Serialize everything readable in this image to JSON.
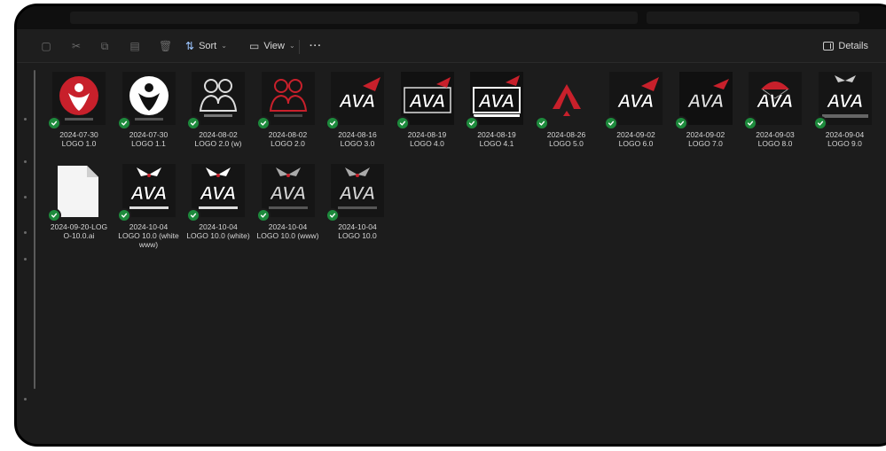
{
  "toolbar": {
    "sort_label": "Sort",
    "view_label": "View",
    "more_label": "···",
    "details_label": "Details"
  },
  "files": [
    {
      "date": "2024-07-30",
      "name": "LOGO 1.0",
      "thumb": "red-circle-figure"
    },
    {
      "date": "2024-07-30",
      "name": "LOGO 1.1",
      "thumb": "white-circle-figure"
    },
    {
      "date": "2024-08-02",
      "name": "LOGO 2.0 (w)",
      "thumb": "outline-people"
    },
    {
      "date": "2024-08-02",
      "name": "LOGO 2.0",
      "thumb": "red-people"
    },
    {
      "date": "2024-08-16",
      "name": "LOGO 3.0",
      "thumb": "ava-arrow"
    },
    {
      "date": "2024-08-19",
      "name": "LOGO 4.0",
      "thumb": "ava-box"
    },
    {
      "date": "2024-08-19",
      "name": "LOGO 4.1",
      "thumb": "ava-box-white"
    },
    {
      "date": "2024-08-26",
      "name": "LOGO 5.0",
      "thumb": "red-triangle"
    },
    {
      "date": "2024-09-02",
      "name": "LOGO 6.0",
      "thumb": "ava-arrow"
    },
    {
      "date": "2024-09-02",
      "name": "LOGO 7.0",
      "thumb": "ava-arrow-dark"
    },
    {
      "date": "2024-09-03",
      "name": "LOGO 8.0",
      "thumb": "ava-parachute"
    },
    {
      "date": "2024-09-04",
      "name": "LOGO 9.0",
      "thumb": "ava-wings"
    },
    {
      "date": "2024-09-20-LOG",
      "name": "O-10.0.ai",
      "thumb": "document"
    },
    {
      "date": "2024-10-04",
      "name": "LOGO 10.0 (white www)",
      "thumb": "ava-wings-white"
    },
    {
      "date": "2024-10-04",
      "name": "LOGO 10.0 (white)",
      "thumb": "ava-wings-white"
    },
    {
      "date": "2024-10-04",
      "name": "LOGO 10.0 (www)",
      "thumb": "ava-wings-dark"
    },
    {
      "date": "2024-10-04",
      "name": "LOGO 10.0",
      "thumb": "ava-wings-dark"
    }
  ],
  "colors": {
    "sync_green": "#1d8a3c",
    "accent_red": "#c8202b",
    "background": "#1c1c1c"
  }
}
